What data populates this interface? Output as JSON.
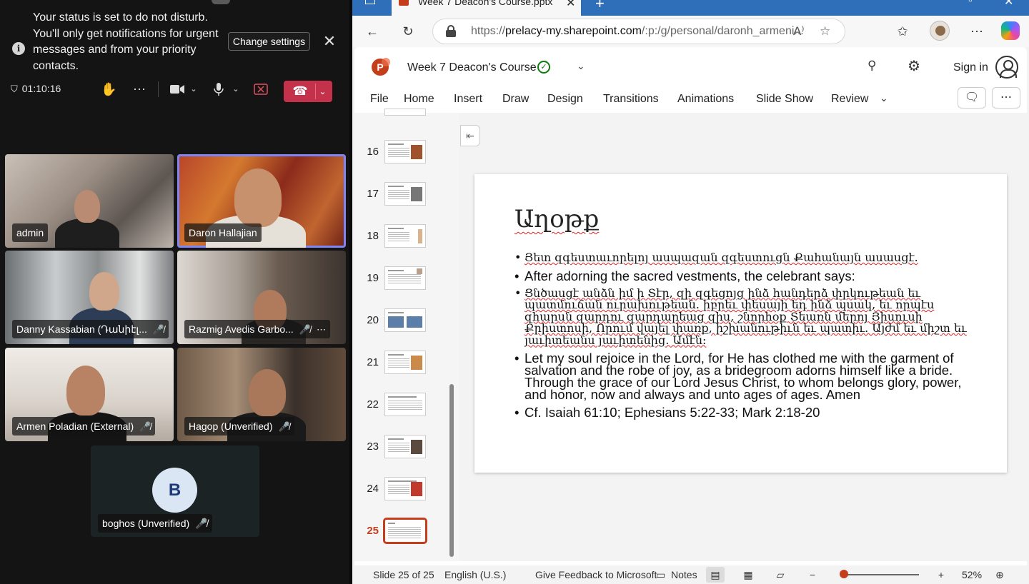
{
  "teams": {
    "notification": {
      "text": "Your status is set to do not disturb. You'll only get notifications for urgent messages and from your priority contacts.",
      "button": "Change settings"
    },
    "timer": "01:10:16",
    "participants": [
      {
        "name": "admin"
      },
      {
        "name": "Daron Hallajian"
      },
      {
        "name": "Danny Kassabian (Դանիէլ..."
      },
      {
        "name": "Razmig Avedis Garbo..."
      },
      {
        "name": "Armen Poladian (External)"
      },
      {
        "name": "Hagop (Unverified)"
      },
      {
        "name": "boghos (Unverified)",
        "initial": "B"
      }
    ]
  },
  "browser": {
    "tab_title": "Week 7 Deacon's Course.pptx",
    "url_prefix": "https://",
    "url_host": "prelacy-my.sharepoint.com",
    "url_path": "/:p:/g/personal/daronh_armeni..."
  },
  "ppt": {
    "file_name": "Week 7 Deacon's Course",
    "sign_in": "Sign in",
    "ribbon": [
      "File",
      "Home",
      "Insert",
      "Draw",
      "Design",
      "Transitions",
      "Animations",
      "Slide Show",
      "Review"
    ],
    "thumbnails": [
      "16",
      "17",
      "18",
      "19",
      "20",
      "21",
      "22",
      "23",
      "24",
      "25"
    ],
    "selected_slide": "25",
    "slide": {
      "title": "Աղօթք",
      "bullets": [
        "Յետ զգեստաւորելոյ ասպազան զգեստուցն Քահանայն ասասցէ.",
        "After adorning the sacred vestments, the celebrant says:",
        "Ցնծասցէ անձն իմ ի Տէր, զի զգեցոյց ինձ հանդերձ փրկութեան եւ պատմուճան ուրախութեան. իբրեւ փեսայի եդ ինձ պսակ, եւ որպէս զհարսն զարդու զարդարեաց զիս, շնորհօք Տեառն մերոյ Յիսուսի Քրիստոսի, Որում վայել փառք, իշխանութիւն եւ պատիւ. Այժմ եւ միշտ եւ յաւիտեանս յաւիտենից. Ամէն:",
        "Let my soul rejoice in the Lord, for He has clothed me with the garment of salvation and the robe of joy, as a bridegroom adorns himself like a bride. Through the grace of our Lord Jesus Christ, to whom belongs glory, power, and honor, now and always and unto ages of ages. Amen",
        "Cf. Isaiah 61:10; Ephesians 5:22-33; Mark 2:18-20"
      ]
    },
    "status": {
      "slide_counter": "Slide 25 of 25",
      "language": "English (U.S.)",
      "feedback": "Give Feedback to Microsoft",
      "notes": "Notes",
      "zoom": "52%"
    }
  }
}
